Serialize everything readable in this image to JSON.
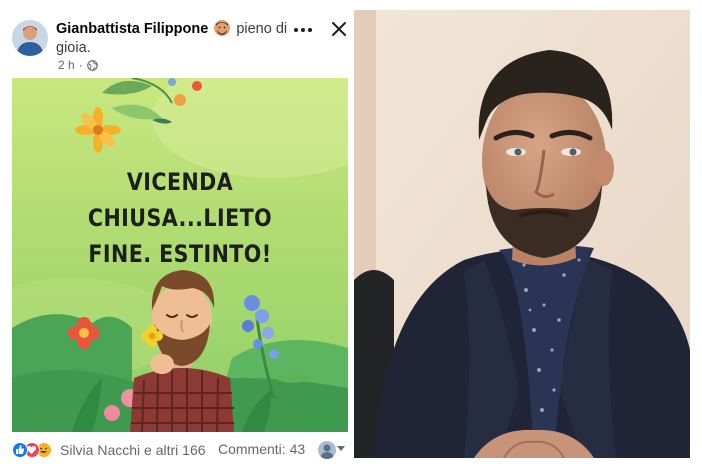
{
  "post": {
    "author_name": "Gianbattista Filippone",
    "feeling_text": "pieno di gioia.",
    "time": "2 h",
    "more_icon": "ellipsis-icon",
    "close_icon": "close-icon",
    "image": {
      "headline_line1": "VICENDA CHIUSA...LIETO",
      "headline_line2": "FINE. ESTINTO!"
    },
    "footer": {
      "reaction_icons": [
        "like-icon",
        "love-icon",
        "haha-icon"
      ],
      "reactions_text": "Silvia Nacchi e altri 166",
      "comments_text": "Commenti: 43"
    }
  },
  "colors": {
    "facebook_blue": "#1877f2",
    "love_red": "#f33e58",
    "haha_yellow": "#f7b125",
    "image_green": "#a8d86a"
  }
}
